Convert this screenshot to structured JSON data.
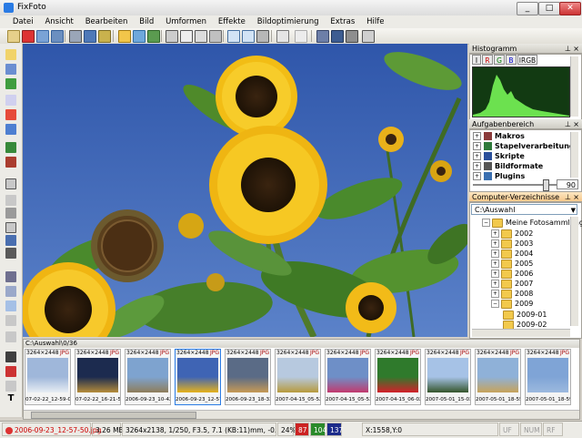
{
  "window": {
    "title": "FixFoto",
    "min": "_",
    "max": "□",
    "close": "✕"
  },
  "menu": [
    "Datei",
    "Ansicht",
    "Bearbeiten",
    "Bild",
    "Umformen",
    "Effekte",
    "Bildoptimierung",
    "Extras",
    "Hilfe"
  ],
  "histogram": {
    "title": "Histogramm",
    "channels": [
      "I",
      "R",
      "G",
      "B",
      "IRGB"
    ]
  },
  "tasks": {
    "title": "Aufgabenbereich",
    "items": [
      "Makros",
      "Stapelverarbeitung",
      "Skripte",
      "Bildformate",
      "Plugins"
    ],
    "slider_value": "90"
  },
  "directories": {
    "title": "Computer-Verzeichnisse",
    "path": "C:\\Auswahl",
    "root": "Meine Fotosammlung",
    "folders": [
      "2002",
      "2003",
      "2004",
      "2005",
      "2006",
      "2007",
      "2008",
      "2009"
    ],
    "subfolders": [
      "2009-01",
      "2009-02"
    ]
  },
  "thumbs": {
    "path": "C:\\Auswahl\\0/36",
    "items": [
      {
        "dims": "3264×2448",
        "fmt": "JPG",
        "cap": "07-02-22_12-59-03",
        "c1": "#9fb7da",
        "c2": "#e7edf3"
      },
      {
        "dims": "3264×2448",
        "fmt": "JPG",
        "cap": "07-02-22_16-21-53",
        "c1": "#1c2b4f",
        "c2": "#b58c3a"
      },
      {
        "dims": "3264×2448",
        "fmt": "JPG",
        "cap": "2006-09-23_10-42-",
        "c1": "#7ea3cf",
        "c2": "#8e7d5a"
      },
      {
        "dims": "3264×2448",
        "fmt": "JPG",
        "cap": "2006-09-23_12-57-",
        "c1": "#3f64b4",
        "c2": "#e6b21c"
      },
      {
        "dims": "3264×2448",
        "fmt": "JPG",
        "cap": "2006-09-23_18-33-",
        "c1": "#5a6b86",
        "c2": "#c79a55"
      },
      {
        "dims": "3264×2448",
        "fmt": "JPG",
        "cap": "2007-04-15_05-52-",
        "c1": "#b7c9df",
        "c2": "#b79a3c"
      },
      {
        "dims": "3264×2448",
        "fmt": "JPG",
        "cap": "2007-04-15_05-53-",
        "c1": "#6e8fc7",
        "c2": "#c23a6e"
      },
      {
        "dims": "3264×2448",
        "fmt": "JPG",
        "cap": "2007-04-15_06-02-",
        "c1": "#2f7a2c",
        "c2": "#d3202a"
      },
      {
        "dims": "3264×2448",
        "fmt": "JPG",
        "cap": "2007-05-01_15-03-",
        "c1": "#a6c2e6",
        "c2": "#35552b"
      },
      {
        "dims": "3264×2448",
        "fmt": "JPG",
        "cap": "2007-05-01_18-55-",
        "c1": "#8fb1d8",
        "c2": "#c7a35a"
      },
      {
        "dims": "3264×2448",
        "fmt": "JPG",
        "cap": "2007-05-01_18-59-",
        "c1": "#7fa4d6",
        "c2": "#9cb9de"
      }
    ]
  },
  "status": {
    "file": "2006-09-23_12-57-50.jpg",
    "size": "3.26 MB",
    "exif": "3264x2138, 1/250, F3.5, 7.1 (KB:11)mm, -0.7EV, ISO:64",
    "zoom": "24%",
    "r": "87",
    "g": "104",
    "b": "137",
    "coords": "X:1558,Y:0",
    "caps": "UF",
    "num": "NUM",
    "scroll": "RF"
  },
  "colors": {
    "accent": "#2a7be4",
    "panel_hover": "#fbd8a0",
    "hist_green": "#7cff5a"
  }
}
